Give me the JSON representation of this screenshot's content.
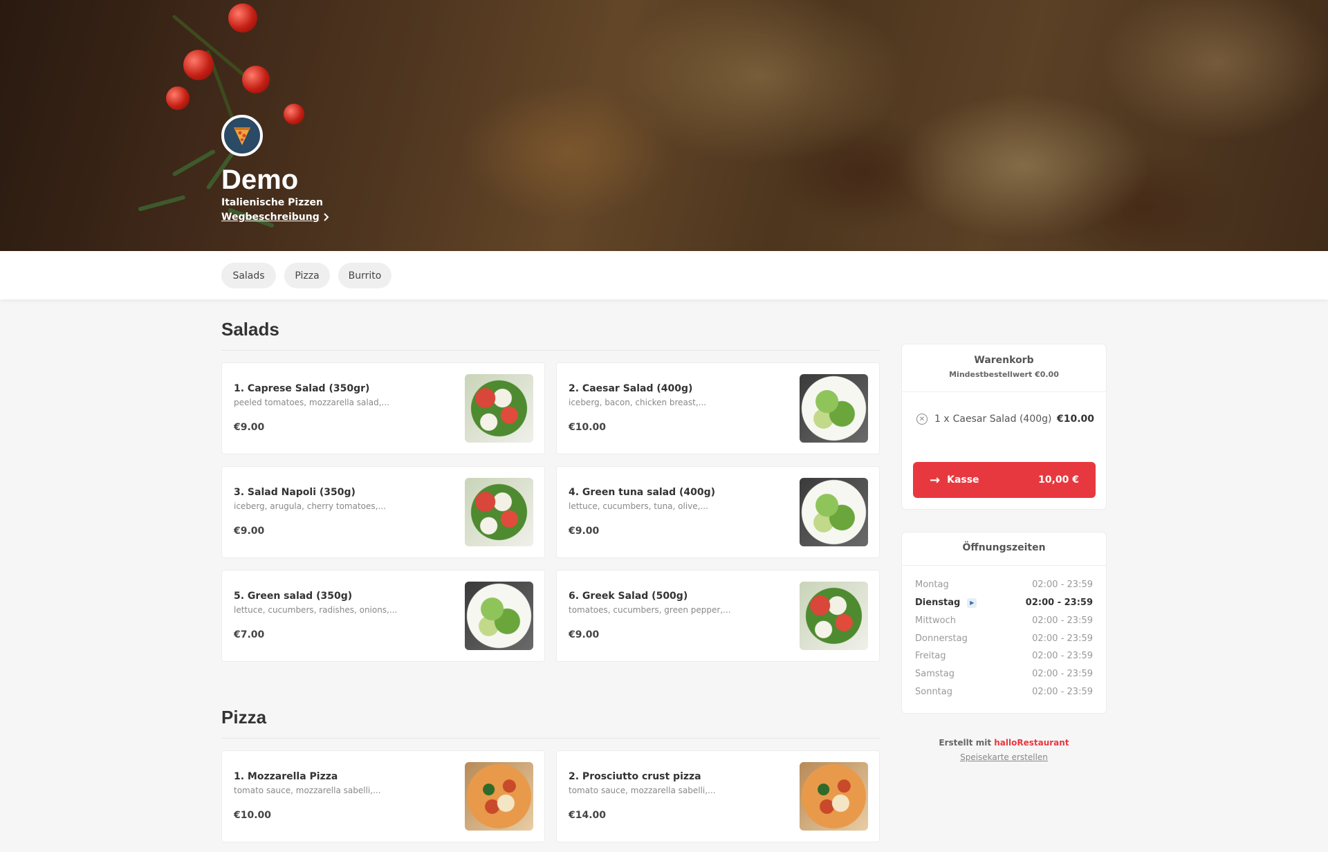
{
  "restaurant": {
    "name": "Demo",
    "tagline": "Italienische Pizzen",
    "directions_label": "Wegbeschreibung"
  },
  "categories": [
    "Salads",
    "Pizza",
    "Burrito"
  ],
  "sections": [
    {
      "title": "Salads",
      "items": [
        {
          "title": "1. Caprese Salad (350gr)",
          "desc": "peeled tomatoes, mozzarella salad,...",
          "price": "€9.00",
          "image": "caprese-salad-photo"
        },
        {
          "title": "2. Caesar Salad (400g)",
          "desc": "iceberg, bacon, chicken breast,...",
          "price": "€10.00",
          "image": "caesar-salad-photo"
        },
        {
          "title": "3. Salad Napoli (350g)",
          "desc": "iceberg, arugula, cherry tomatoes,...",
          "price": "€9.00",
          "image": "salad-napoli-photo"
        },
        {
          "title": "4. Green tuna salad (400g)",
          "desc": "lettuce, cucumbers, tuna, olive,...",
          "price": "€9.00",
          "image": "green-tuna-salad-photo"
        },
        {
          "title": "5. Green salad (350g)",
          "desc": "lettuce, cucumbers, radishes, onions,...",
          "price": "€7.00",
          "image": "green-salad-photo"
        },
        {
          "title": "6. Greek Salad (500g)",
          "desc": "tomatoes, cucumbers, green pepper,...",
          "price": "€9.00",
          "image": "greek-salad-photo"
        }
      ]
    },
    {
      "title": "Pizza",
      "items": [
        {
          "title": "1. Mozzarella Pizza",
          "desc": "tomato sauce, mozzarella sabelli,...",
          "price": "€10.00",
          "image": "mozzarella-pizza-photo"
        },
        {
          "title": "2. Prosciutto crust pizza",
          "desc": "tomato sauce, mozzarella sabelli,...",
          "price": "€14.00",
          "image": "prosciutto-pizza-photo"
        }
      ]
    }
  ],
  "cart": {
    "title": "Warenkorb",
    "minimum": "Mindestbestellwert €0.00",
    "items": [
      {
        "qty": "1 x",
        "name": "Caesar Salad (400g)",
        "price": "€10.00"
      }
    ],
    "checkout_label": "Kasse",
    "checkout_total": "10,00 €"
  },
  "hours": {
    "title": "Öffnungszeiten",
    "today_index": 1,
    "rows": [
      {
        "day": "Montag",
        "time": "02:00 - 23:59"
      },
      {
        "day": "Dienstag",
        "time": "02:00 - 23:59"
      },
      {
        "day": "Mittwoch",
        "time": "02:00 - 23:59"
      },
      {
        "day": "Donnerstag",
        "time": "02:00 - 23:59"
      },
      {
        "day": "Freitag",
        "time": "02:00 - 23:59"
      },
      {
        "day": "Samstag",
        "time": "02:00 - 23:59"
      },
      {
        "day": "Sonntag",
        "time": "02:00 - 23:59"
      }
    ]
  },
  "footer": {
    "created_prefix": "Erstellt mit",
    "brand": "halloRestaurant",
    "create_menu_link": "Speisekarte erstellen"
  },
  "colors": {
    "accent": "#e8383f",
    "logo_bg": "#2a4a66"
  }
}
